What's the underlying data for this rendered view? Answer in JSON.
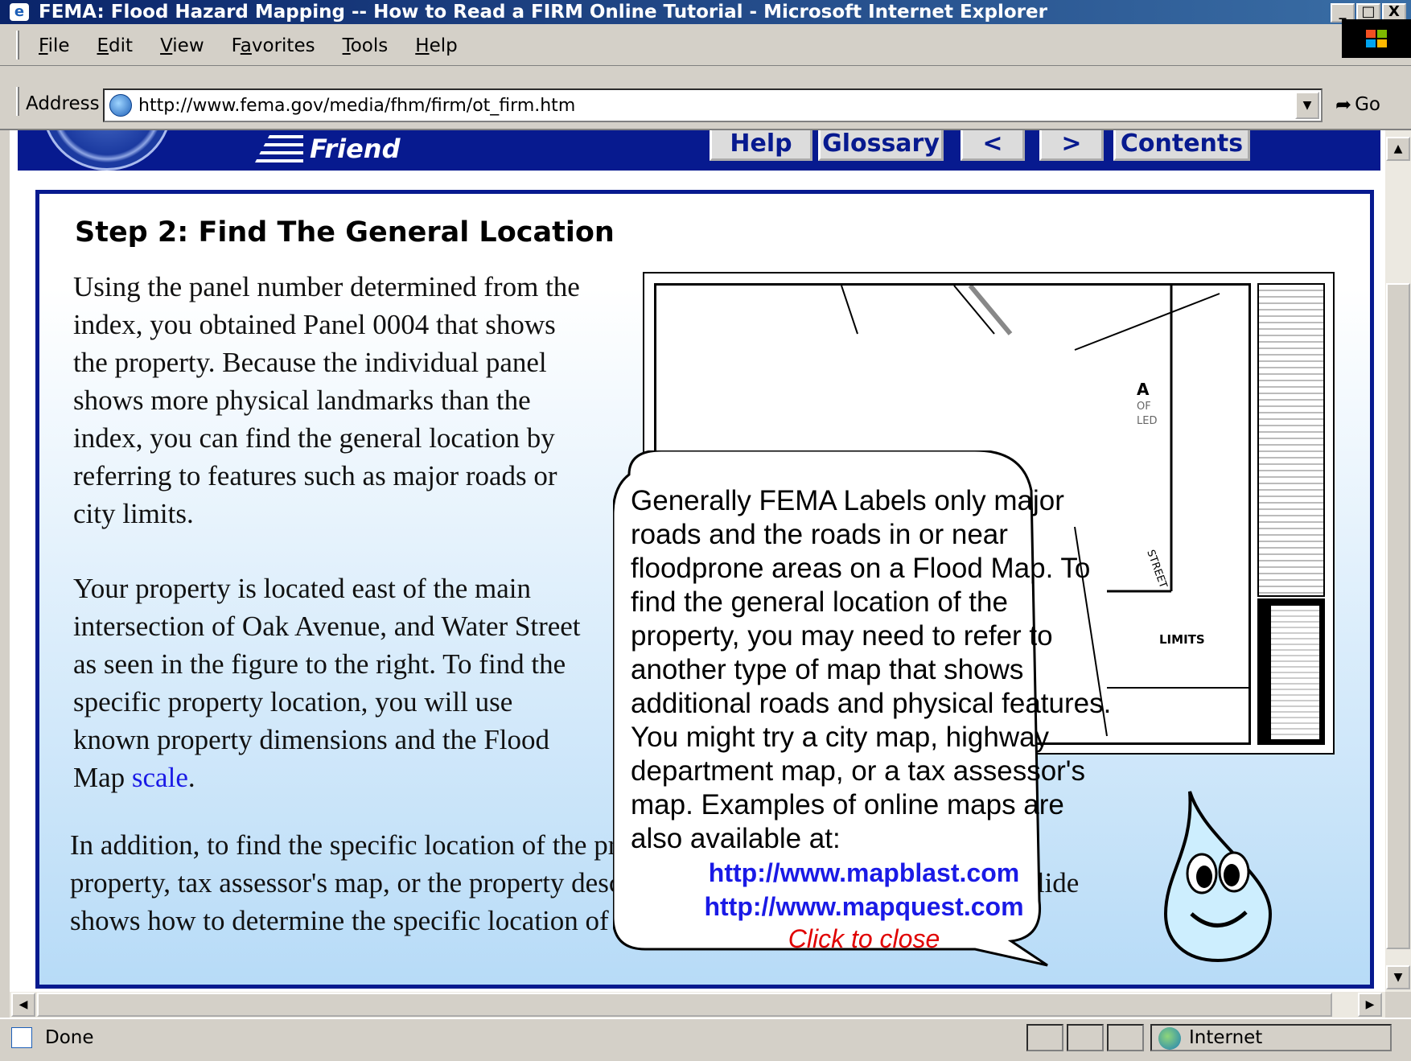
{
  "window": {
    "title": "FEMA: Flood Hazard Mapping -- How to Read a FIRM Online Tutorial - Microsoft Internet Explorer",
    "controls": [
      "_",
      "□",
      "X"
    ]
  },
  "menu": {
    "items": [
      {
        "label": "File",
        "u": "F",
        "rest": "ile"
      },
      {
        "label": "Edit",
        "u": "E",
        "rest": "dit"
      },
      {
        "label": "View",
        "u": "V",
        "rest": "iew"
      },
      {
        "label": "Favorites",
        "pre": "F",
        "u": "a",
        "rest": "vorites"
      },
      {
        "label": "Tools",
        "u": "T",
        "rest": "ools"
      },
      {
        "label": "Help",
        "u": "H",
        "rest": "elp"
      }
    ]
  },
  "address": {
    "label": "Address",
    "url": "http://www.fema.gov/media/fhm/firm/ot_firm.htm",
    "go_label": "Go"
  },
  "site_nav": {
    "tell_friend": "Friend",
    "buttons": [
      "Help",
      "Glossary",
      "<",
      ">",
      "Contents"
    ]
  },
  "content": {
    "step_title": "Step 2: Find The General Location",
    "para1": "Using the panel number determined from the index, you obtained Panel 0004 that shows the property. Because the individual panel shows more physical landmarks than the index, you can find the general location by referring to features such as major roads or city limits.",
    "para2_before": "Your property is located east of the main intersection of Oak Avenue, and Water Street as seen in the figure to the right. To find the specific property location, you will use known property dimensions and the Flood Map ",
    "para2_link": "scale",
    "para2_after": ".",
    "para3": "In addition, to find the specific location of the property, you may need a survey of the property, tax assessor's map, or the property description found on the deed. The next slide shows how to determine the specific location of the property."
  },
  "map": {
    "limits_label": "LIMITS",
    "street_label": "STREET",
    "a_label": "A",
    "of_label": "OF",
    "led_label": "LED"
  },
  "bubble": {
    "text": "Generally FEMA Labels only major roads and the roads in or near floodprone areas on a Flood Map. To find the general location of the property, you may need to refer to another type of map that shows additional roads and physical features. You might try a city map, highway department map, or a tax assessor's map. Examples of online maps are also available at:",
    "link1": "http://www.mapblast.com",
    "link2": "http://www.mapquest.com",
    "close": "Click to close"
  },
  "status": {
    "text": "Done",
    "zone": "Internet"
  },
  "colors": {
    "header_blue": "#071a8f",
    "link_blue": "#1a1ae6",
    "close_red": "#e00000",
    "panel_gradient_end": "#b7dbf7"
  }
}
